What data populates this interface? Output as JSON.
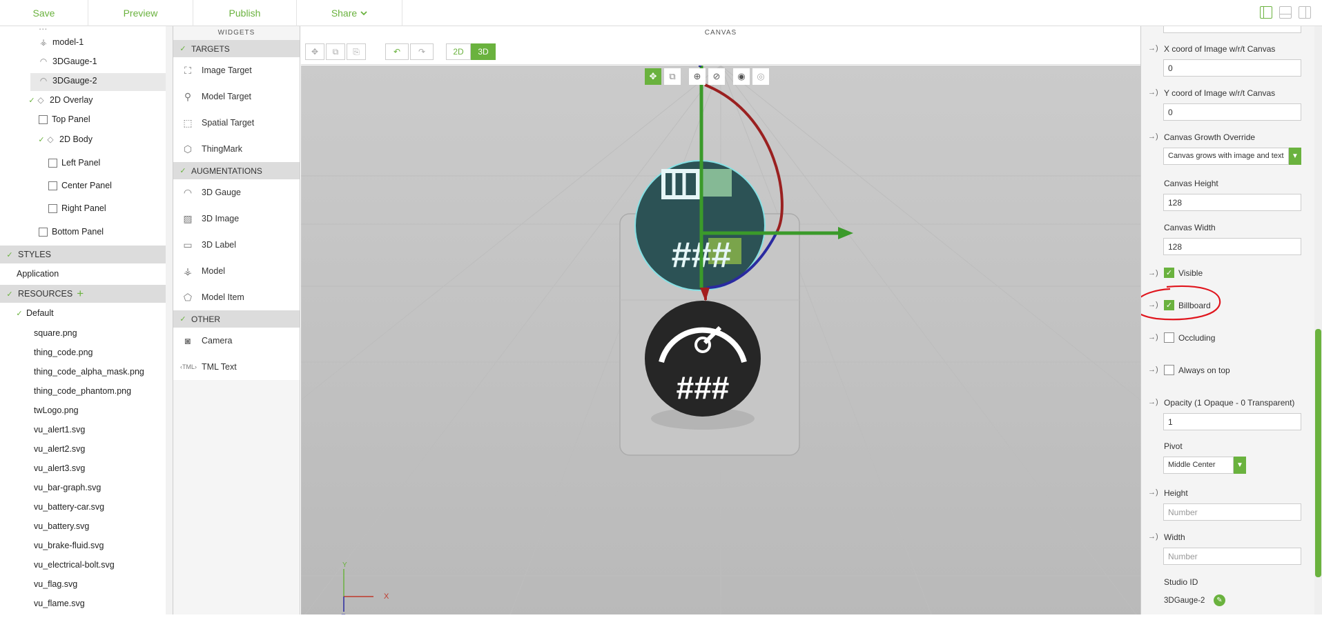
{
  "topbar": {
    "save": "Save",
    "preview": "Preview",
    "publish": "Publish",
    "share": "Share"
  },
  "tree": {
    "items": [
      {
        "label": "model-1",
        "icon": "model-icon"
      },
      {
        "label": "3DGauge-1",
        "icon": "gauge-icon"
      },
      {
        "label": "3DGauge-2",
        "icon": "gauge-icon"
      },
      {
        "label": "2D Overlay",
        "icon": "overlay-icon"
      },
      {
        "label": "Top Panel",
        "icon": "panel-icon"
      },
      {
        "label": "2D Body",
        "icon": "overlay-icon"
      },
      {
        "label": "Left Panel",
        "icon": "panel-icon"
      },
      {
        "label": "Center Panel",
        "icon": "panel-icon"
      },
      {
        "label": "Right Panel",
        "icon": "panel-icon"
      },
      {
        "label": "Bottom Panel",
        "icon": "panel-icon"
      }
    ],
    "styles_header": "STYLES",
    "styles_item": "Application",
    "resources_header": "RESOURCES",
    "default_folder": "Default",
    "files": [
      "square.png",
      "thing_code.png",
      "thing_code_alpha_mask.png",
      "thing_code_phantom.png",
      "twLogo.png",
      "vu_alert1.svg",
      "vu_alert2.svg",
      "vu_alert3.svg",
      "vu_bar-graph.svg",
      "vu_battery-car.svg",
      "vu_battery.svg",
      "vu_brake-fluid.svg",
      "vu_electrical-bolt.svg",
      "vu_flag.svg",
      "vu_flame.svg"
    ]
  },
  "widgets": {
    "header": "WIDGETS",
    "targets_header": "TARGETS",
    "targets": [
      "Image Target",
      "Model Target",
      "Spatial Target",
      "ThingMark"
    ],
    "augmentations_header": "AUGMENTATIONS",
    "augmentations": [
      "3D Gauge",
      "3D Image",
      "3D Label",
      "Model",
      "Model Item"
    ],
    "other_header": "OTHER",
    "other": [
      "Camera",
      "TML Text"
    ]
  },
  "canvas": {
    "header": "CANVAS",
    "mode_2d": "2D",
    "mode_3d": "3D",
    "gauge_text_top": "###",
    "gauge_text_bottom": "###",
    "axis_y": "Y",
    "axis_x": "X",
    "axis_z": "Z"
  },
  "props": {
    "x_coord_label": "X coord of Image w/r/t Canvas",
    "x_coord_value": "0",
    "y_coord_label": "Y coord of Image w/r/t Canvas",
    "y_coord_value": "0",
    "growth_label": "Canvas Growth Override",
    "growth_value": "Canvas grows with image and text",
    "canvas_height_label": "Canvas Height",
    "canvas_height_value": "128",
    "canvas_width_label": "Canvas Width",
    "canvas_width_value": "128",
    "visible_label": "Visible",
    "visible_checked": true,
    "billboard_label": "Billboard",
    "billboard_checked": true,
    "occluding_label": "Occluding",
    "occluding_checked": false,
    "always_on_top_label": "Always on top",
    "always_on_top_checked": false,
    "opacity_label": "Opacity (1 Opaque - 0 Transparent)",
    "opacity_value": "1",
    "pivot_label": "Pivot",
    "pivot_value": "Middle Center",
    "height_label": "Height",
    "height_placeholder": "Number",
    "width_label": "Width",
    "width_placeholder": "Number",
    "studio_id_label": "Studio ID",
    "studio_id_value": "3DGauge-2"
  },
  "colors": {
    "accent": "#6ab23e",
    "annotation": "#e0161e"
  }
}
